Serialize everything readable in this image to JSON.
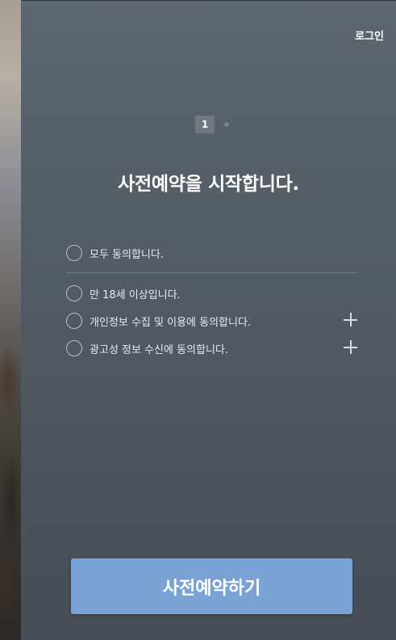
{
  "header": {
    "login_label": "로그인"
  },
  "steps": {
    "current": "1"
  },
  "title": "사전예약을 시작합니다.",
  "agreements": {
    "all": "모두 동의합니다.",
    "items": [
      {
        "label": "만 18세 이상입니다.",
        "has_detail": false
      },
      {
        "label": "개인정보 수집 및 이용에 동의합니다.",
        "has_detail": true
      },
      {
        "label": "광고성 정보 수신에 동의합니다.",
        "has_detail": true
      }
    ]
  },
  "cta": {
    "label": "사전예약하기"
  },
  "colors": {
    "panel": "#535b65",
    "cta": "#7aa2d4",
    "text": "#ffffff"
  }
}
